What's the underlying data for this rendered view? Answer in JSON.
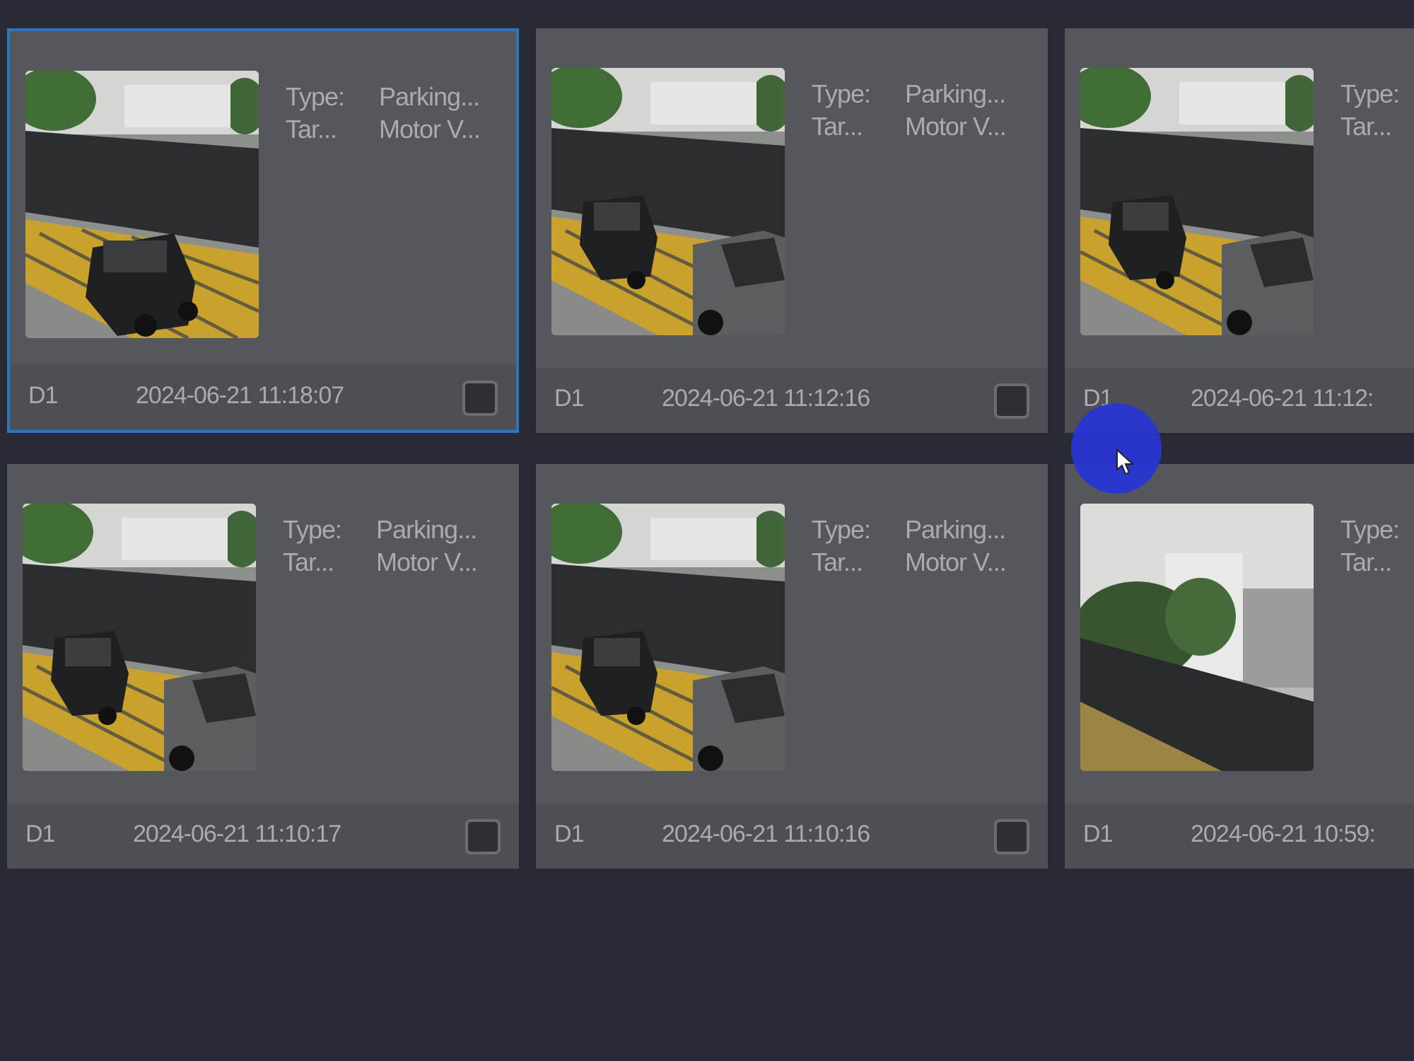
{
  "cards": [
    {
      "type_key": "Type:",
      "type_val": "Parking...",
      "target_key": "Tar...",
      "target_val": "Motor V...",
      "channel": "D1",
      "time": "2024-06-21 11:18:07",
      "selected": true,
      "thumb": "parking-lot-suv"
    },
    {
      "type_key": "Type:",
      "type_val": "Parking...",
      "target_key": "Tar...",
      "target_val": "Motor V...",
      "channel": "D1",
      "time": "2024-06-21 11:12:16",
      "selected": false,
      "thumb": "parking-lot-two-cars"
    },
    {
      "type_key": "Type:",
      "type_val": "",
      "target_key": "Tar...",
      "target_val": "",
      "channel": "D1",
      "time": "2024-06-21 11:12:",
      "selected": false,
      "thumb": "parking-lot-two-cars"
    },
    {
      "type_key": "Type:",
      "type_val": "Parking...",
      "target_key": "Tar...",
      "target_val": "Motor V...",
      "channel": "D1",
      "time": "2024-06-21 11:10:17",
      "selected": false,
      "thumb": "parking-lot-two-cars"
    },
    {
      "type_key": "Type:",
      "type_val": "Parking...",
      "target_key": "Tar...",
      "target_val": "Motor V...",
      "channel": "D1",
      "time": "2024-06-21 11:10:16",
      "selected": false,
      "thumb": "parking-lot-two-cars"
    },
    {
      "type_key": "Type:",
      "type_val": "",
      "target_key": "Tar...",
      "target_val": "",
      "channel": "D1",
      "time": "2024-06-21 10:59:",
      "selected": false,
      "thumb": "building-street"
    }
  ],
  "colors": {
    "background": "#272a33",
    "card": "#55575d",
    "selected_border": "#2f76b8",
    "cursor_highlight": "#2734d6"
  },
  "icons": {
    "checkbox": "checkbox-icon",
    "cursor": "mouse-cursor-icon"
  }
}
